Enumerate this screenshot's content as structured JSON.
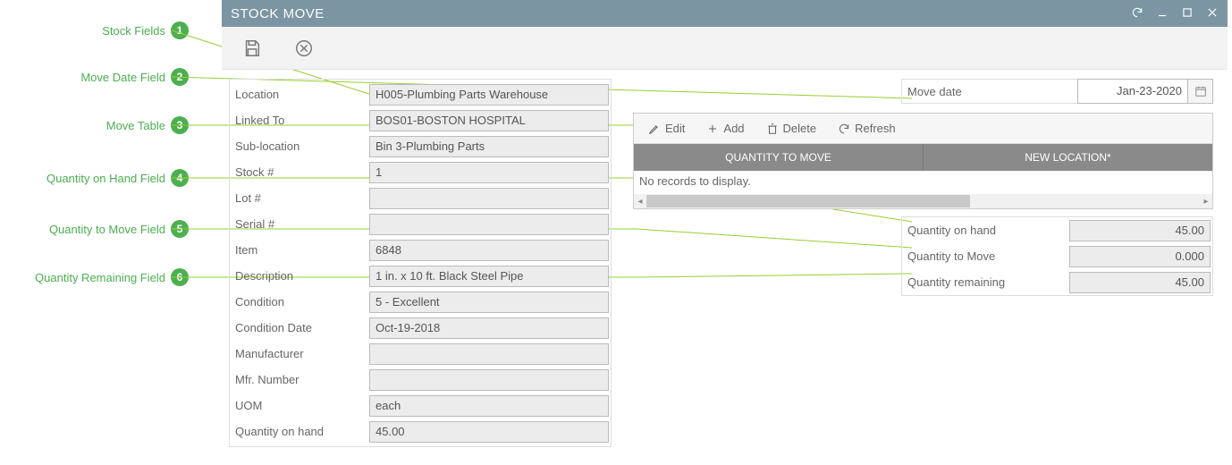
{
  "annotations": [
    {
      "n": "1",
      "label": "Stock Fields"
    },
    {
      "n": "2",
      "label": "Move Date Field"
    },
    {
      "n": "3",
      "label": "Move Table"
    },
    {
      "n": "4",
      "label": "Quantity on Hand Field"
    },
    {
      "n": "5",
      "label": "Quantity to Move Field"
    },
    {
      "n": "6",
      "label": "Quantity Remaining Field"
    }
  ],
  "window": {
    "title": "STOCK MOVE"
  },
  "form": {
    "location_label": "Location",
    "location": "H005-Plumbing Parts Warehouse",
    "linked_label": "Linked To",
    "linked": "BOS01-BOSTON HOSPITAL",
    "subloc_label": "Sub-location",
    "subloc": "Bin 3-Plumbing Parts",
    "stockno_label": "Stock #",
    "stockno": "1",
    "lot_label": "Lot #",
    "lot": "",
    "serial_label": "Serial #",
    "serial": "",
    "item_label": "Item",
    "item": "6848",
    "desc_label": "Description",
    "desc": "1 in. x 10 ft. Black Steel Pipe",
    "cond_label": "Condition",
    "cond": "5 - Excellent",
    "conddate_label": "Condition Date",
    "conddate": "Oct-19-2018",
    "mfr_label": "Manufacturer",
    "mfr": "",
    "mfrno_label": "Mfr. Number",
    "mfrno": "",
    "uom_label": "UOM",
    "uom": "each",
    "qoh_label": "Quantity on hand",
    "qoh": "45.00"
  },
  "movedate": {
    "label": "Move date",
    "value": "Jan-23-2020"
  },
  "grid": {
    "buttons": {
      "edit": "Edit",
      "add": "Add",
      "delete": "Delete",
      "refresh": "Refresh"
    },
    "columns": {
      "qty": "QUANTITY TO MOVE",
      "loc": "NEW LOCATION*"
    },
    "empty": "No records to display."
  },
  "qty": {
    "onhand_label": "Quantity on hand",
    "onhand": "45.00",
    "tomove_label": "Quantity to Move",
    "tomove": "0.000",
    "remain_label": "Quantity remaining",
    "remain": "45.00"
  }
}
